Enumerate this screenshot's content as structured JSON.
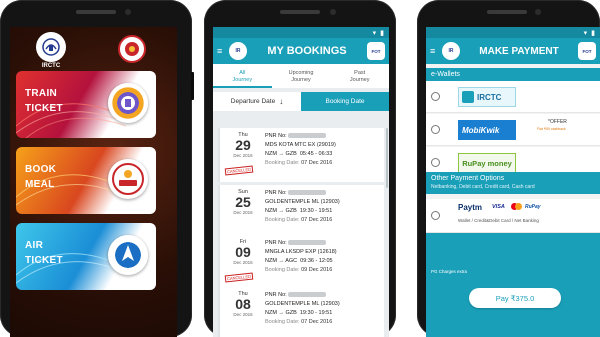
{
  "brand": {
    "primary": "#1a9fb8",
    "primary_dark": "#14899f",
    "cancel_red": "#c22222"
  },
  "screen1": {
    "logo_text": "IRCTC",
    "cards": [
      {
        "label_line1": "TRAIN",
        "label_line2": "TICKET",
        "icon": "irctc-train-logo"
      },
      {
        "label_line1": "BOOK",
        "label_line2": "MEAL",
        "icon": "food-on-track-logo"
      },
      {
        "label_line1": "AIR",
        "label_line2": "TICKET",
        "icon": "irctc-air-logo"
      }
    ]
  },
  "screen2": {
    "title": "MY BOOKINGS",
    "tabs": [
      {
        "line1": "All",
        "line2": "Journey"
      },
      {
        "line1": "Upcoming",
        "line2": "Journey"
      },
      {
        "line1": "Past",
        "line2": "Journey"
      }
    ],
    "sort_departure": "Departure Date",
    "sort_booking": "Booking Date",
    "bookings": [
      {
        "dow": "Thu",
        "day": "29",
        "month_year": "Dec 2016",
        "pnr_label": "PNR No:",
        "train": "MDS KOTA MTC EX (29019)",
        "from": "NZM",
        "to": "GZB",
        "time": "05:45 - 06:33",
        "booking_label": "Booking Date:",
        "booking_date": "07 Dec 2016",
        "cancelled": "CANCELLED"
      },
      {
        "dow": "Sun",
        "day": "25",
        "month_year": "Dec 2016",
        "pnr_label": "PNR No:",
        "train": "GOLDENTEMPLE ML (12903)",
        "from": "NZM",
        "to": "GZB",
        "time": "19:30 - 19:51",
        "booking_label": "Booking Date:",
        "booking_date": "07 Dec 2016",
        "cancelled": ""
      },
      {
        "dow": "Fri",
        "day": "09",
        "month_year": "Dec 2016",
        "pnr_label": "PNR No:",
        "train": "MNGLA LKSDP EXP (12618)",
        "from": "NZM",
        "to": "AGC",
        "time": "09:36 - 12:05",
        "booking_label": "Booking Date:",
        "booking_date": "09 Dec 2016",
        "cancelled": "CANCELLED"
      },
      {
        "dow": "Thu",
        "day": "08",
        "month_year": "Dec 2016",
        "pnr_label": "PNR No:",
        "train": "GOLDENTEMPLE ML (12903)",
        "from": "NZM",
        "to": "GZB",
        "time": "19:30 - 19:51",
        "booking_label": "Booking Date:",
        "booking_date": "07 Dec 2016",
        "cancelled": ""
      }
    ]
  },
  "screen3": {
    "title": "MAKE PAYMENT",
    "ewallets_header": "e-Wallets",
    "wallets": [
      "IRCTC",
      "MobiKwik",
      "RuPay money"
    ],
    "mobikwik_offer_title": "*OFFER",
    "mobikwik_offer_text": "Flat ₹50 cashback",
    "other_header": "Other Payment Options",
    "other_sub": "Netbanking, Debit card, Credit card, Cash card",
    "paytm_brand": "Paytm",
    "card_brands": [
      "VISA",
      "RuPay"
    ],
    "paytm_desc": "Wallet / Credit&Debit Card / Net Banking",
    "pg_note": "PG Charges extra",
    "pay_button": "Pay ₹375.0"
  }
}
